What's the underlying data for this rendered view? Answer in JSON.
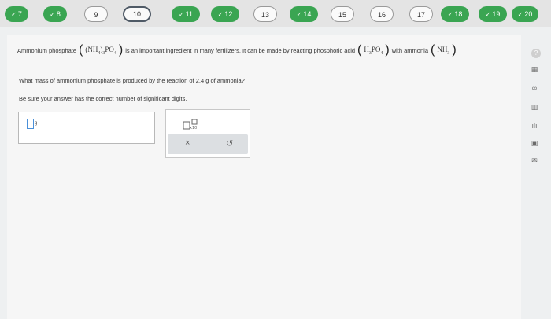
{
  "progress": [
    {
      "label": "7",
      "done": true
    },
    {
      "label": "8",
      "done": true
    },
    {
      "label": "9",
      "done": false
    },
    {
      "label": "10",
      "done": false,
      "current": true
    },
    {
      "label": "11",
      "done": true
    },
    {
      "label": "12",
      "done": true
    },
    {
      "label": "13",
      "done": false
    },
    {
      "label": "14",
      "done": true
    },
    {
      "label": "15",
      "done": false
    },
    {
      "label": "16",
      "done": false
    },
    {
      "label": "17",
      "done": false
    },
    {
      "label": "18",
      "done": true
    },
    {
      "label": "19",
      "done": true
    },
    {
      "label": "20",
      "done": true
    }
  ],
  "question": {
    "intro_prefix": "Ammonium phosphate",
    "formula_main": "(NH",
    "formula_sub1": "4",
    "formula_mid": ")",
    "formula_sub2": "3",
    "formula_end": "PO",
    "formula_sub3": "4",
    "intro_middle": "is an important ingredient in many fertilizers. It can be made by reacting phosphoric acid",
    "acid_h": "H",
    "acid_sub1": "3",
    "acid_po": "PO",
    "acid_sub2": "4",
    "with_text": "with ammonia",
    "ammonia": "NH",
    "ammonia_sub": "3",
    "prompt": "What mass of ammonium phosphate is produced by the reaction of 2.4 g of ammonia?",
    "instruction": "Be sure your answer has the correct number of significant digits."
  },
  "answer": {
    "value": "",
    "unit": "g"
  },
  "tools": {
    "clear_symbol": "×",
    "undo_symbol": "↺"
  },
  "sidebar": {
    "help_label": "?",
    "ids": [
      "help-icon",
      "calculator-icon",
      "glasses-icon",
      "periodic-table-icon",
      "chart-icon",
      "reference-icon",
      "mail-icon"
    ],
    "glyphs": [
      "?",
      "▦",
      "∞",
      "▥",
      "ılı",
      "▣",
      "✉"
    ]
  }
}
